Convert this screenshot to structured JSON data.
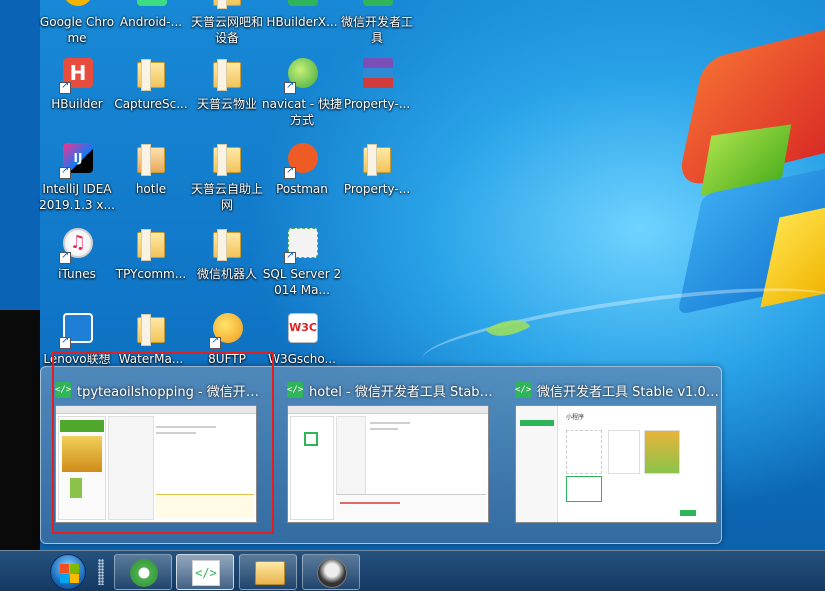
{
  "desktop_icons": [
    {
      "name": "Google\nChrome",
      "label": "Google Chrome"
    },
    {
      "label": "Android-..."
    },
    {
      "label": "天普云网吧和设备"
    },
    {
      "label": "HBuilderX..."
    },
    {
      "label": "微信开发者工具"
    },
    {
      "label": "HBuilder"
    },
    {
      "label": "CaptureSc..."
    },
    {
      "label": "天普云物业"
    },
    {
      "label": "navicat - 快捷方式"
    },
    {
      "label": "Property-..."
    },
    {
      "label": "IntelliJ IDEA 2019.1.3 x..."
    },
    {
      "label": "hotle"
    },
    {
      "label": "天普云自助上网"
    },
    {
      "label": "Postman"
    },
    {
      "label": "Property-..."
    },
    {
      "label": "iTunes"
    },
    {
      "label": "TPYcomm..."
    },
    {
      "label": "微信机器人"
    },
    {
      "label": "SQL Server 2014 Ma..."
    },
    {
      "label": "Lenovo联想"
    },
    {
      "label": "WaterMa..."
    },
    {
      "label": "8UFTP"
    },
    {
      "label": "W3Gscho..."
    }
  ],
  "previews": [
    {
      "title": "tpyteaoilshopping - 微信开发..."
    },
    {
      "title": "hotel - 微信开发者工具 Stable..."
    },
    {
      "title": "微信开发者工具 Stable v1.02.1..."
    }
  ],
  "thumb_texts": {
    "mini_program": "小程序"
  },
  "icons": {
    "devtools": "</>"
  },
  "colors": {
    "wechat_green": "#2fb45a",
    "highlight_red": "#e02020"
  }
}
